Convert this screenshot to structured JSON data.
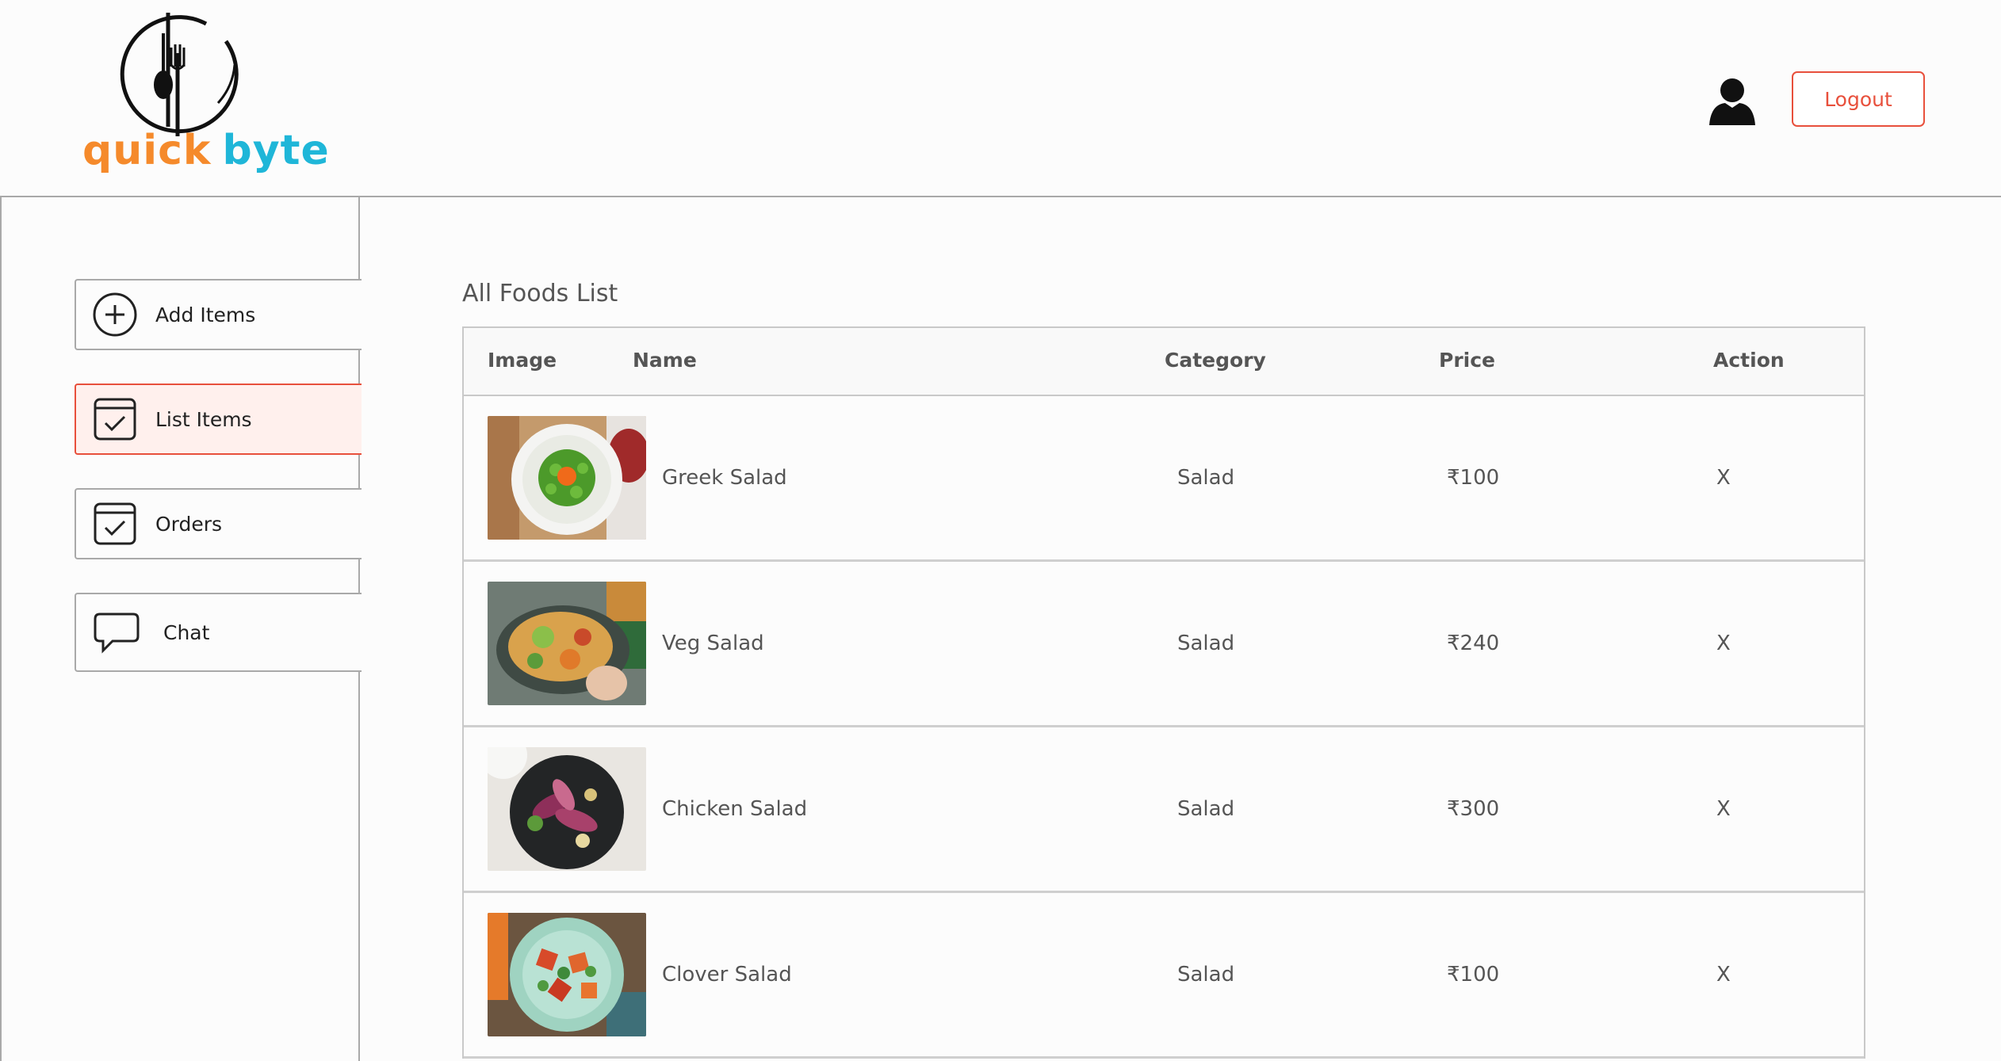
{
  "brand": {
    "word1": "quick",
    "word2": "byte"
  },
  "header": {
    "logout_label": "Logout"
  },
  "sidebar": {
    "items": [
      {
        "label": "Add Items",
        "icon": "add-circle-icon",
        "active": false
      },
      {
        "label": "List Items",
        "icon": "checklist-icon",
        "active": true
      },
      {
        "label": "Orders",
        "icon": "checklist-icon",
        "active": false
      },
      {
        "label": "Chat",
        "icon": "chat-bubble-icon",
        "active": false
      }
    ]
  },
  "main": {
    "title": "All Foods List",
    "columns": [
      "Image",
      "Name",
      "Category",
      "Price",
      "Action"
    ],
    "rows": [
      {
        "name": "Greek Salad",
        "category": "Salad",
        "price": "₹100",
        "action": "X"
      },
      {
        "name": "Veg Salad",
        "category": "Salad",
        "price": "₹240",
        "action": "X"
      },
      {
        "name": "Chicken Salad",
        "category": "Salad",
        "price": "₹300",
        "action": "X"
      },
      {
        "name": "Clover Salad",
        "category": "Salad",
        "price": "₹100",
        "action": "X"
      }
    ]
  },
  "colors": {
    "accent": "#e8503c",
    "brand_orange": "#f58a2b",
    "brand_cyan": "#1fb6d8",
    "active_bg": "#fff0ed"
  }
}
